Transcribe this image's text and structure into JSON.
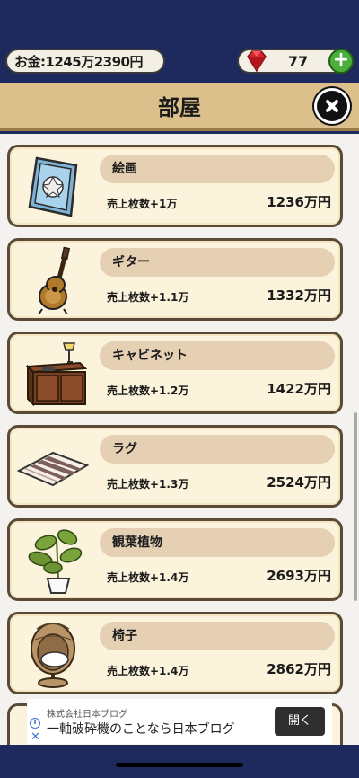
{
  "status": {
    "money": "お金:1245万2390円",
    "gems": "77",
    "add_icon": "plus-icon"
  },
  "header": {
    "title": "部屋",
    "close_icon": "close-icon"
  },
  "items": [
    {
      "name": "絵画",
      "bonus": "売上枚数+1万",
      "price": "1236万円",
      "icon": "painting-icon"
    },
    {
      "name": "ギター",
      "bonus": "売上枚数+1.1万",
      "price": "1332万円",
      "icon": "guitar-icon"
    },
    {
      "name": "キャビネット",
      "bonus": "売上枚数+1.2万",
      "price": "1422万円",
      "icon": "cabinet-icon"
    },
    {
      "name": "ラグ",
      "bonus": "売上枚数+1.3万",
      "price": "2524万円",
      "icon": "rug-icon"
    },
    {
      "name": "観葉植物",
      "bonus": "売上枚数+1.4万",
      "price": "2693万円",
      "icon": "plant-icon"
    },
    {
      "name": "椅子",
      "bonus": "売上枚数+1.4万",
      "price": "2862万円",
      "icon": "chair-icon"
    }
  ],
  "ad": {
    "company": "株式会社日本ブログ",
    "headline": "一軸破砕機のことなら日本ブログ",
    "button": "開く",
    "info_icon": "i",
    "close_icon": "✕"
  },
  "colors": {
    "navy": "#1e2a5e",
    "title_bar": "#dcc08c",
    "card": "#fbf3dc",
    "name_bar": "#e6d0b4",
    "add_green": "#4caf3b",
    "gem_red": "#d9262e"
  }
}
